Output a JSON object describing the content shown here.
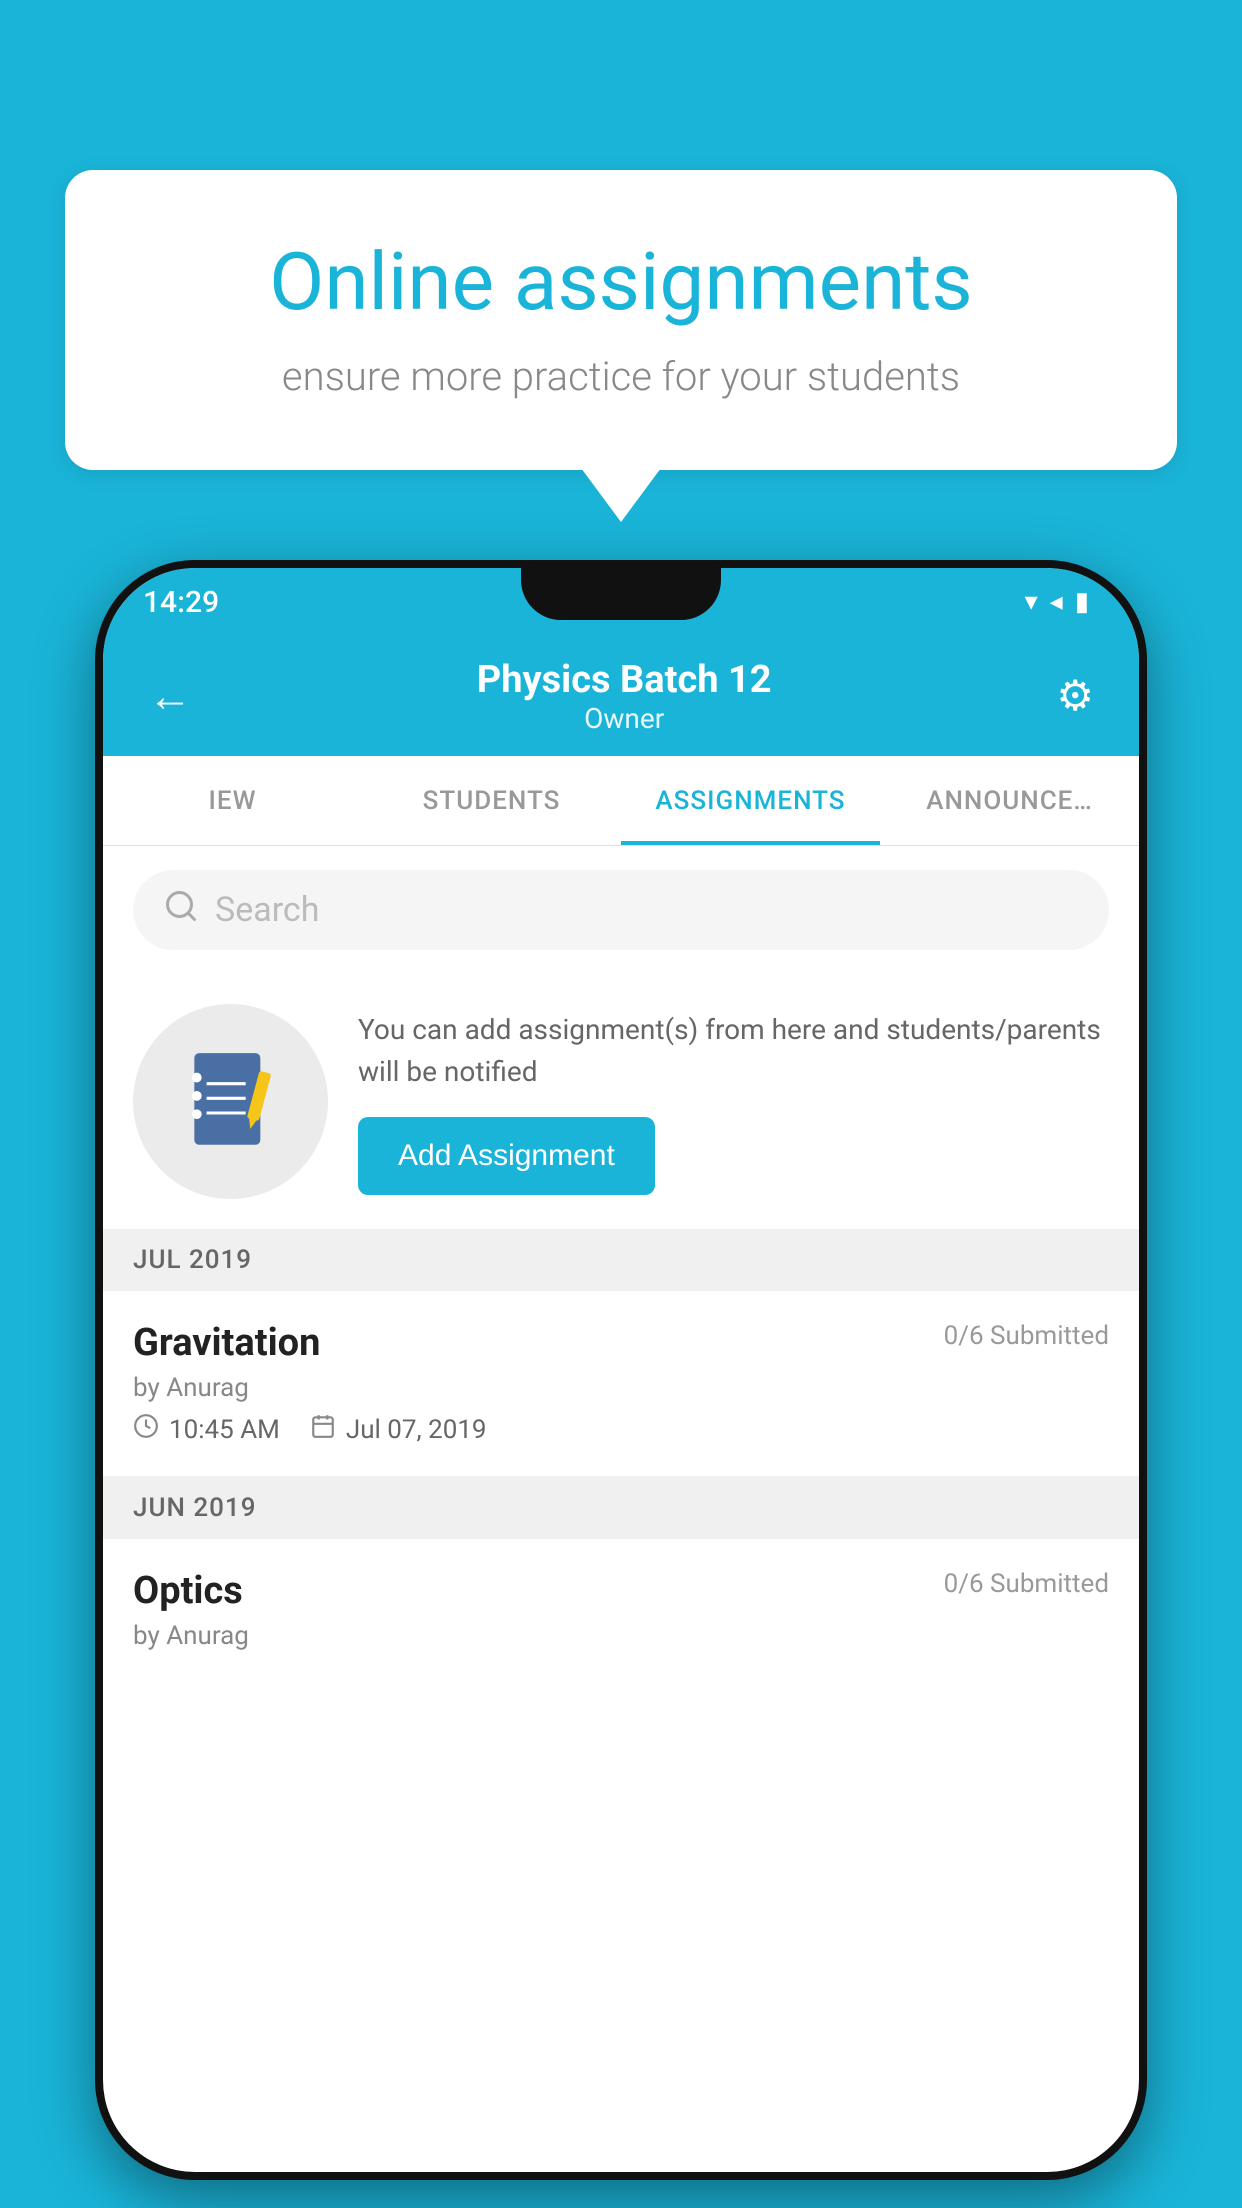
{
  "background_color": "#1ab4d8",
  "promo": {
    "title": "Online assignments",
    "subtitle": "ensure more practice for your students"
  },
  "status_bar": {
    "time": "14:29",
    "icons": [
      "wifi",
      "signal",
      "battery"
    ]
  },
  "app_bar": {
    "title": "Physics Batch 12",
    "subtitle": "Owner",
    "back_label": "←",
    "settings_label": "⚙"
  },
  "tabs": [
    {
      "label": "IEW",
      "active": false
    },
    {
      "label": "STUDENTS",
      "active": false
    },
    {
      "label": "ASSIGNMENTS",
      "active": true
    },
    {
      "label": "ANNOUNCE…",
      "active": false
    }
  ],
  "search": {
    "placeholder": "Search"
  },
  "assignment_promo": {
    "info_text": "You can add assignment(s) from here and students/parents will be notified",
    "button_label": "Add Assignment"
  },
  "sections": [
    {
      "header": "JUL 2019",
      "assignments": [
        {
          "name": "Gravitation",
          "submitted": "0/6 Submitted",
          "author": "by Anurag",
          "time": "10:45 AM",
          "date": "Jul 07, 2019"
        }
      ]
    },
    {
      "header": "JUN 2019",
      "assignments": [
        {
          "name": "Optics",
          "submitted": "0/6 Submitted",
          "author": "by Anurag",
          "time": "",
          "date": ""
        }
      ]
    }
  ]
}
